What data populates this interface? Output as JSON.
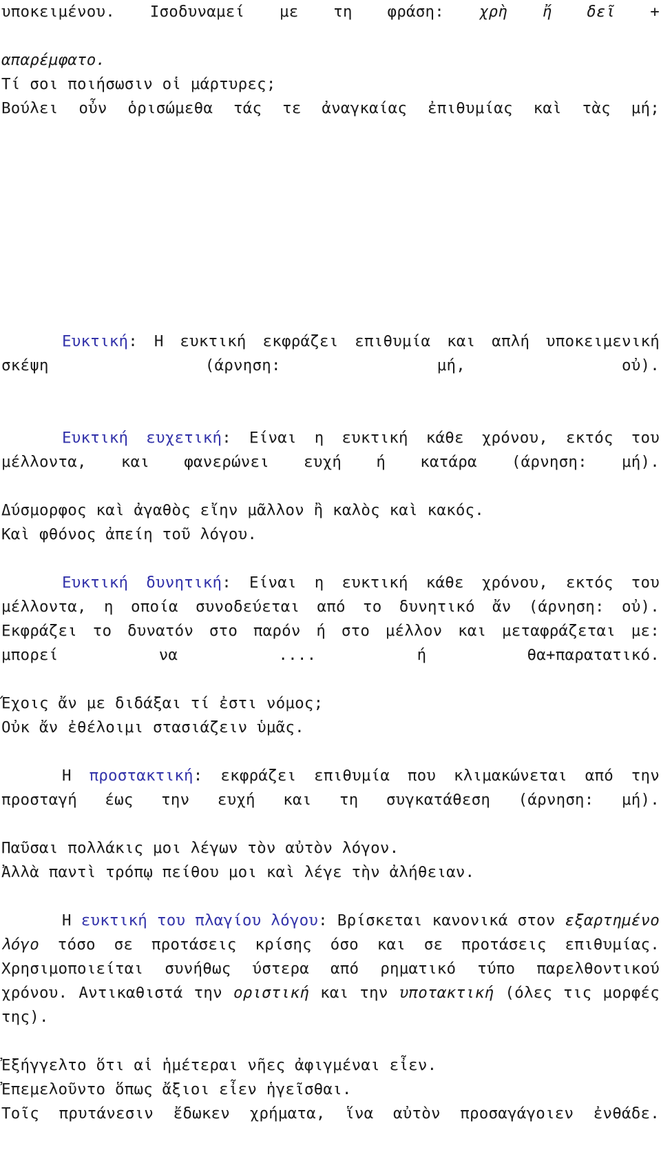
{
  "document": {
    "language": "el",
    "title_visible": false,
    "colors": {
      "heading_blue": "#3333aa",
      "body_text": "#1a1a1a",
      "background": "#ffffff"
    },
    "blocks": [
      {
        "id": "intro",
        "lines": [
          "υποκειμένου. Ισοδυναμεί με τη φράση: ",
          "απαρέμφατο.",
          "Τί σοι ποιήσωσιν οἱ μάρτυρες;",
          "Βούλει οὖν ὁρισώμεθα τάς τε ἀναγκαίας ἐπιθυμίας καὶ τὰς μή;"
        ],
        "italic_fragment": "χρὴ ἤ δεῖ +"
      }
    ],
    "sections": {
      "euktiki": {
        "heading": "Ευκτική",
        "colon": ":",
        "body": " Η ευκτική εκφράζει επιθυμία και απλή υποκειμενική σκέψη (άρνηση: μή, οὐ)."
      },
      "euktiki_euchetiki": {
        "heading": "Ευκτική ευχετική",
        "colon": ":",
        "body": " Είναι η ευκτική κάθε χρόνου, εκτός του μέλλοντα, και φανερώνει ευχή ή κατάρα (άρνηση: μή).",
        "examples": [
          "Δύσμορφος καὶ ἀγαθὸς εἴην μᾶλλον ἢ καλὸς καὶ κακός.",
          "Καὶ φθόνος ἀπείη τοῦ λόγου."
        ]
      },
      "euktiki_dynitiki": {
        "heading": "Ευκτική δυνητική",
        "colon": ":",
        "body": " Είναι η ευκτική κάθε χρόνου, εκτός του μέλλοντα, η οποία συνοδεύεται από το δυνητικό ἄν (άρνηση: οὐ). Εκφράζει το δυνατόν στο παρόν ή στο μέλλον και μεταφράζεται με: μπορεί να .... ή θα+παρατατικό.",
        "examples": [
          "Ἔχοις ἄν με διδάξαι τί ἐστι νόμος;",
          "Οὐκ ἄν ἐθέλοιμι στασιάζειν ὑμᾶς."
        ]
      },
      "prostaktiki": {
        "lead": "Η ",
        "heading": "προστακτική",
        "colon": ":",
        "body": " εκφράζει επιθυμία που κλιμακώνεται από την προσταγή έως την ευχή και τη συγκατάθεση (άρνηση: μή).",
        "examples": [
          "Παῦσαι πολλάκις μοι λέγων τὸν αὐτὸν λόγον.",
          "Ἀλλὰ παντὶ τρόπῳ πείθου μοι καὶ λέγε τὴν ἀλήθειαν."
        ]
      },
      "euktiki_plagiou": {
        "lead": "Η ",
        "heading": "ευκτική του πλαγίου λόγου",
        "colon": ":",
        "body_1": " Βρίσκεται κανονικά στον ",
        "italic_1": "εξαρτημένο λόγο",
        "body_2": " τόσο σε προτάσεις κρίσης όσο και σε προτάσεις επιθυμίας. Χρησιμοποιείται συνήθως ύστερα από ρηματικό τύπο παρελθοντικού χρόνου. Αντικαθιστά την ",
        "italic_2": "οριστική",
        "body_3": " και την ",
        "italic_3": "υποτακτική",
        "body_4": " (όλες τις μορφές της).",
        "examples": [
          "Ἐξήγγελτο ὅτι αἱ ἡμέτεραι νῆες ἀφιγμέναι εἶεν.",
          "Ἐπεμελοῦντο ὅπως ἄξιοι εἶεν ἡγεῖσθαι.",
          "Τοῖς πρυτάνεσιν ἔδωκεν χρήματα, ἵνα αὐτὸν προσαγάγοιεν ἐνθάδε."
        ]
      }
    }
  }
}
